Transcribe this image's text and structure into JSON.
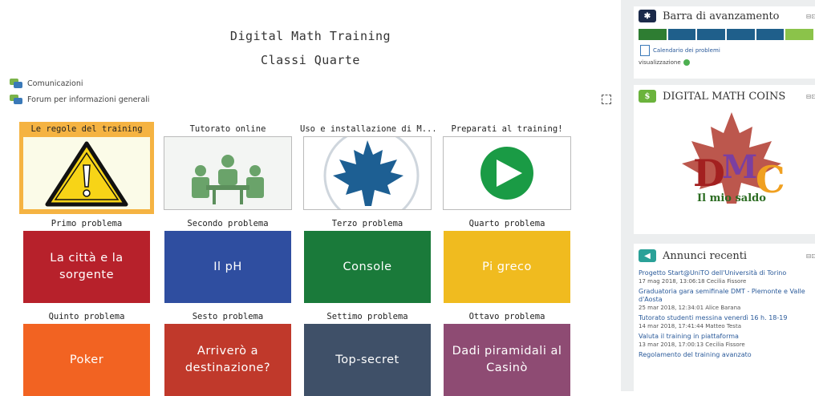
{
  "course": {
    "title": "Digital Math Training",
    "subtitle": "Classi Quarte"
  },
  "links": [
    {
      "label": "Comunicazioni",
      "icon": "forum-icon"
    },
    {
      "label": "Forum per informazioni generali",
      "icon": "forum-icon"
    }
  ],
  "tiles_top": [
    {
      "label": "Le regole del training",
      "image": "warning-icon",
      "active": true
    },
    {
      "label": "Tutorato online",
      "image": "group-meeting-icon"
    },
    {
      "label": "Uso e installazione di M...",
      "image": "maple-leaf-icon"
    },
    {
      "label": "Preparati al training!",
      "image": "play-icon"
    }
  ],
  "problems": [
    {
      "label": "Primo problema",
      "text": "La città e la sorgente",
      "color": "#b7212b"
    },
    {
      "label": "Secondo problema",
      "text": "Il pH",
      "color": "#2f4ea0"
    },
    {
      "label": "Terzo problema",
      "text": "Console",
      "color": "#1a7a3a"
    },
    {
      "label": "Quarto problema",
      "text": "Pi greco",
      "color": "#f0bb1f"
    },
    {
      "label": "Quinto problema",
      "text": "Poker",
      "color": "#f26322"
    },
    {
      "label": "Sesto problema",
      "text": "Arriverò a destinazione?",
      "color": "#c0392b"
    },
    {
      "label": "Settimo problema",
      "text": "Top-secret",
      "color": "#3f5068"
    },
    {
      "label": "Ottavo problema",
      "text": "Dadi piramidali al Casinò",
      "color": "#8e4b73"
    }
  ],
  "sidebar": {
    "progress": {
      "title": "Barra di avanzamento",
      "segments": [
        "#2e7d32",
        "#1f5f8b",
        "#1f5f8b",
        "#1f5f8b",
        "#1f5f8b",
        "#8bc34a"
      ],
      "calendar_label": "Calendario dei problemi",
      "view_label": "visualizzazione"
    },
    "coins": {
      "title": "DIGITAL MATH COINS",
      "logo_text": "DMC",
      "caption": "Il mio saldo"
    },
    "news": {
      "title": "Annunci recenti",
      "items": [
        {
          "title": "Progetto Start@UniTO dell'Università di Torino",
          "meta": "17 mag 2018, 13:06:18 Cecilia Fissore"
        },
        {
          "title": "Graduatoria gara semifinale DMT - Piemonte e Valle d'Aosta",
          "meta": "25 mar 2018, 12:34:01 Alice Barana"
        },
        {
          "title": "Tutorato studenti messina venerdì 16 h. 18-19",
          "meta": "14 mar 2018, 17:41:44 Matteo Testa"
        },
        {
          "title": "Valuta il training in piattaforma",
          "meta": "13 mar 2018, 17:00:13 Cecilia Fissore"
        },
        {
          "title": "Regolamento del training avanzato",
          "meta": ""
        }
      ]
    }
  }
}
